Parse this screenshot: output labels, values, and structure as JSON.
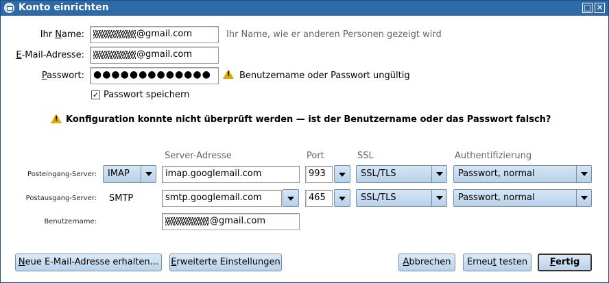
{
  "window": {
    "title": "Konto einrichten",
    "maximize_glyph": "□",
    "close_glyph": "✕"
  },
  "identity": {
    "name_label": "Ihr Name:",
    "name_value": "@gmail.com",
    "name_hint": "Ihr Name, wie er anderen Personen gezeigt wird",
    "email_label": "E-Mail-Adresse:",
    "email_value": "@gmail.com",
    "password_label": "Passwort:",
    "password_value": "●●●●●●●●●●●●●",
    "password_warning": "Benutzername oder Passwort ungültig",
    "remember_password_label": "Passwort speichern",
    "remember_password_checked": true
  },
  "config_warning": "Konfiguration konnte nicht überprüft werden — ist der Benutzername oder das Passwort falsch?",
  "server_table": {
    "headers": {
      "server_address": "Server-Adresse",
      "port": "Port",
      "ssl": "SSL",
      "auth": "Authentifizierung"
    },
    "incoming": {
      "label": "Posteingang-Server:",
      "protocol": "IMAP",
      "host": "imap.googlemail.com",
      "port": "993",
      "ssl": "SSL/TLS",
      "auth": "Passwort, normal"
    },
    "outgoing": {
      "label": "Postausgang-Server:",
      "protocol": "SMTP",
      "host": "smtp.googlemail.com",
      "port": "465",
      "ssl": "SSL/TLS",
      "auth": "Passwort, normal"
    },
    "username": {
      "label": "Benutzername:",
      "value": "@gmail.com"
    }
  },
  "buttons": {
    "new_email": "Neue E-Mail-Adresse erhalten...",
    "advanced": "Erweiterte Einstellungen",
    "cancel": "Abbrechen",
    "retest": "Erneut testen",
    "done": "Fertig"
  },
  "icons": {
    "warning": "warning-icon",
    "check": "check-icon",
    "dropdown": "chevron-down-icon"
  }
}
